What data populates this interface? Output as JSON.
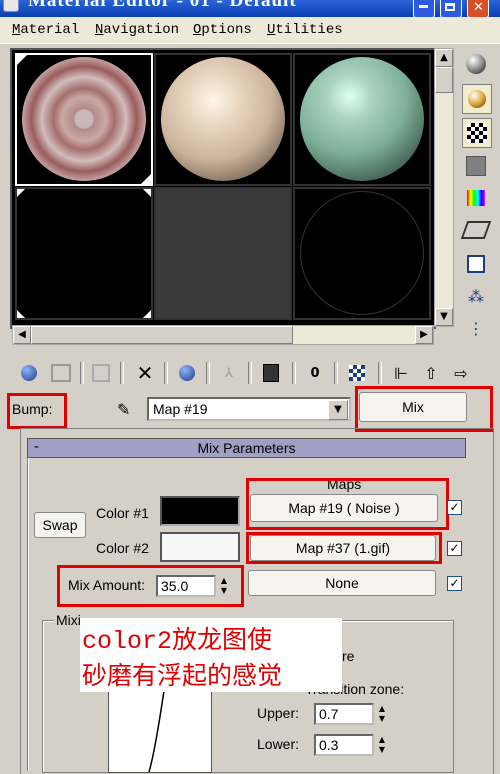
{
  "window": {
    "title": "Material Editor - 01 - Default",
    "title_visible": "Material Editor - 01 - Default"
  },
  "menu": [
    "Material",
    "Navigation",
    "Options",
    "Utilities"
  ],
  "sample_slots": [
    {
      "name": "dragon-texture",
      "kind": "textured",
      "selected": true
    },
    {
      "name": "beige",
      "kind": "sphere",
      "color": "#d9c4b0"
    },
    {
      "name": "green",
      "kind": "sphere",
      "color": "#7fb09a"
    },
    {
      "name": "black",
      "kind": "sphere",
      "color": "#000000"
    },
    {
      "name": "empty",
      "kind": "gray"
    },
    {
      "name": "dark",
      "kind": "sphere",
      "color": "#000000"
    }
  ],
  "side_toolbar": [
    "sample-type-sphere-icon",
    "backlight-icon",
    "checker-background-icon",
    "sample-uv-tiling-icon",
    "video-color-check-icon",
    "make-preview-icon",
    "options-icon",
    "select-by-material-icon",
    "material-map-navigator-icon"
  ],
  "toolbar_icons": [
    "get-material-icon",
    "put-to-scene-icon",
    "assign-material-icon",
    "reset-map-icon",
    "copy-material-icon",
    "make-unique-icon",
    "put-to-library-icon",
    "material-id-channel-icon",
    "show-map-icon",
    "show-end-result-icon",
    "go-to-parent-icon",
    "go-forward-icon"
  ],
  "bump": {
    "label": "Bump:",
    "map_name": "Map #19",
    "map_type": "Mix"
  },
  "rollout": {
    "minus": "-",
    "title": "Mix Parameters",
    "maps_header": "Maps",
    "swap_label": "Swap",
    "color1_label": "Color #1",
    "color2_label": "Color #2",
    "color1": "#000000",
    "color2": "#f6f6f6",
    "map1": "Map #19  ( Noise )",
    "map2": "Map #37 (1.gif)",
    "map3": "None",
    "mix_amount_label": "Mix Amount:",
    "mix_amount": "35.0",
    "mixing_curve_label": "Mixi",
    "use_curve_label": "re",
    "transition_zone_label": "Transition zone:",
    "upper_label": "Upper:",
    "upper": "0.7",
    "lower_label": "Lower:",
    "lower": "0.3"
  },
  "annotation": {
    "line1": "color2放龙图使",
    "line2": "砂磨有浮起的感觉",
    "color": "#e00000"
  }
}
